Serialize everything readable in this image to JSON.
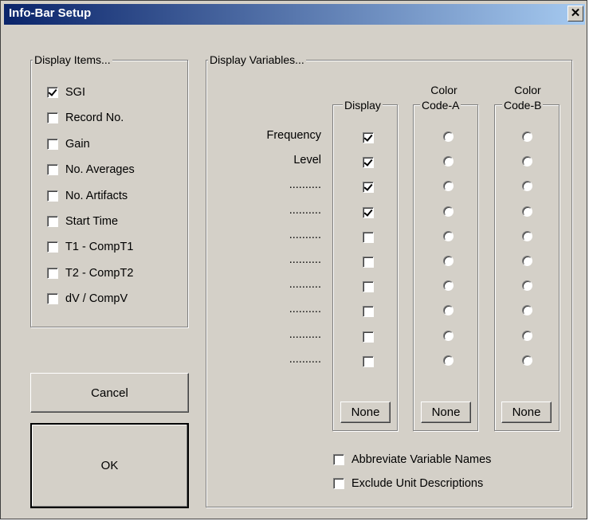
{
  "window": {
    "title": "Info-Bar Setup",
    "close_glyph": "✕"
  },
  "display_items": {
    "legend": "Display Items...",
    "items": [
      {
        "label": "SGI",
        "checked": true
      },
      {
        "label": "Record No.",
        "checked": false
      },
      {
        "label": "Gain",
        "checked": false
      },
      {
        "label": "No. Averages",
        "checked": false
      },
      {
        "label": "No. Artifacts",
        "checked": false
      },
      {
        "label": "Start Time",
        "checked": false
      },
      {
        "label": "T1 - CompT1",
        "checked": false
      },
      {
        "label": "T2 - CompT2",
        "checked": false
      },
      {
        "label": "dV / CompV",
        "checked": false
      }
    ]
  },
  "buttons": {
    "cancel": "Cancel",
    "ok": "OK"
  },
  "display_variables": {
    "legend": "Display Variables...",
    "display_col": {
      "legend": "Display",
      "none_label": "None"
    },
    "color_a_col": {
      "header_line1": "Color",
      "legend": "Code-A",
      "none_label": "None"
    },
    "color_b_col": {
      "header_line1": "Color",
      "legend": "Code-B",
      "none_label": "None"
    },
    "variables": [
      {
        "label": "Frequency",
        "display": true
      },
      {
        "label": "Level",
        "display": true
      },
      {
        "label": "..........",
        "display": true
      },
      {
        "label": "..........",
        "display": true
      },
      {
        "label": "..........",
        "display": false
      },
      {
        "label": "..........",
        "display": false
      },
      {
        "label": "..........",
        "display": false
      },
      {
        "label": "..........",
        "display": false
      },
      {
        "label": "..........",
        "display": false
      },
      {
        "label": "..........",
        "display": false
      }
    ],
    "abbreviate": {
      "label": "Abbreviate Variable Names",
      "checked": false
    },
    "exclude_units": {
      "label": "Exclude Unit Descriptions",
      "checked": false
    }
  }
}
